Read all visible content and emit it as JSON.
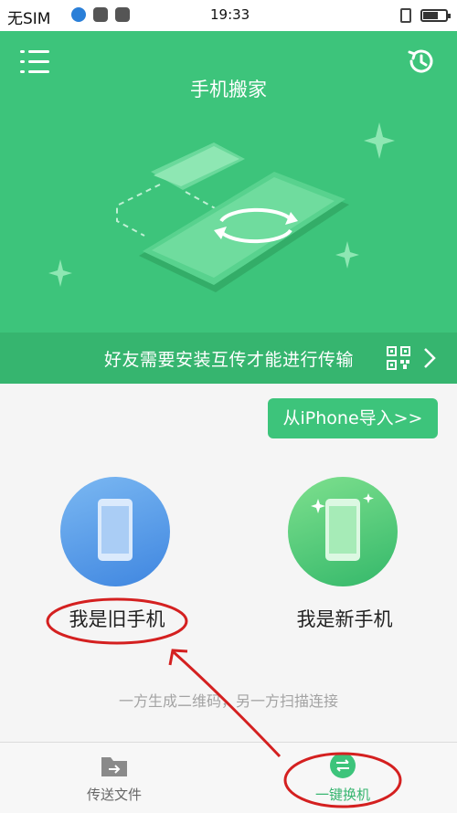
{
  "status_bar": {
    "carrier": "无SIM",
    "time": "19:33"
  },
  "header": {
    "title": "手机搬家",
    "menu_icon": "menu-icon",
    "history_icon": "history-icon"
  },
  "tip": {
    "text": "好友需要安装互传才能进行传输",
    "qr_icon": "qr-code-icon",
    "arrow_icon": "chevron-right-icon"
  },
  "iphone_import": {
    "label": "从iPhone导入>>"
  },
  "roles": {
    "old_phone": {
      "label": "我是旧手机"
    },
    "new_phone": {
      "label": "我是新手机"
    }
  },
  "hint": "一方生成二维码，另一方扫描连接",
  "tabs": [
    {
      "label": "传送文件",
      "icon": "folder-transfer-icon",
      "active": false
    },
    {
      "label": "一键换机",
      "icon": "swap-icon",
      "active": true
    }
  ],
  "colors": {
    "primary": "#3dc47b",
    "tip_bar": "#36b56f",
    "old_phone": "#5a9ee8",
    "new_phone": "#4fcb78",
    "annotation": "#d42020"
  }
}
